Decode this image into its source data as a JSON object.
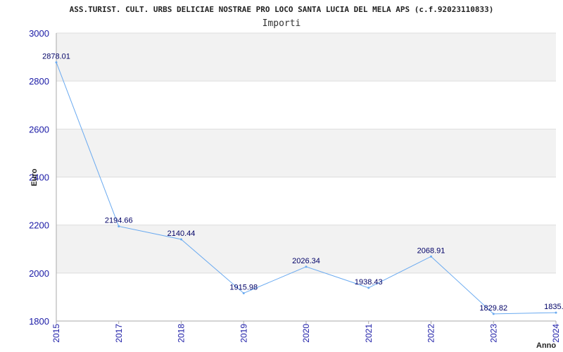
{
  "chart_data": {
    "type": "line",
    "title": "ASS.TURIST. CULT. URBS DELICIAE NOSTRAE PRO LOCO SANTA LUCIA DEL MELA APS (c.f.92023110833)",
    "subtitle": "Importi",
    "xlabel": "Anno",
    "ylabel": "Euro",
    "ylim": [
      1800,
      3000
    ],
    "yticks": [
      "1800",
      "2000",
      "2200",
      "2400",
      "2600",
      "2800",
      "3000"
    ],
    "grid": true,
    "legend": "none",
    "line_color": "#6aaaf0",
    "categories": [
      "2015",
      "2017",
      "2018",
      "2019",
      "2020",
      "2021",
      "2022",
      "2023",
      "2024"
    ],
    "series": [
      {
        "values": [
          2878.01,
          2194.66,
          2140.44,
          1915.98,
          2026.34,
          1938.43,
          2068.91,
          1829.82,
          1835.0
        ],
        "labels": [
          "2878.01",
          "2194.66",
          "2140.44",
          "1915.98",
          "2026.34",
          "1938.43",
          "2068.91",
          "1829.82",
          "1835.0"
        ]
      }
    ]
  }
}
